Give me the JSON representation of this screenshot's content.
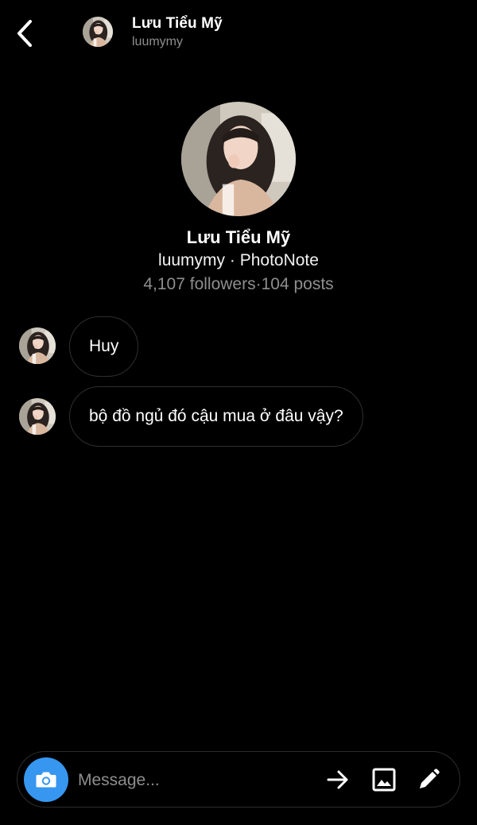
{
  "header": {
    "back_icon": "chevron-left-icon",
    "name": "Lưu Tiểu Mỹ",
    "handle": "luumymy"
  },
  "profile": {
    "name": "Lưu Tiểu Mỹ",
    "subtitle": "luumymy · PhotoNote",
    "stats": "4,107 followers·104 posts"
  },
  "messages": [
    {
      "text": "Huy"
    },
    {
      "text": "bộ đồ ngủ đó cậu mua ở đâu vậy?"
    }
  ],
  "composer": {
    "placeholder": "Message...",
    "camera_icon": "camera-icon",
    "send_icon": "arrow-right-icon",
    "gallery_icon": "image-icon",
    "sticker_icon": "pencil-icon"
  },
  "colors": {
    "background": "#000000",
    "accent": "#3797f0",
    "muted_text": "#8e8e8e",
    "bubble_border": "#2f2f2f"
  }
}
